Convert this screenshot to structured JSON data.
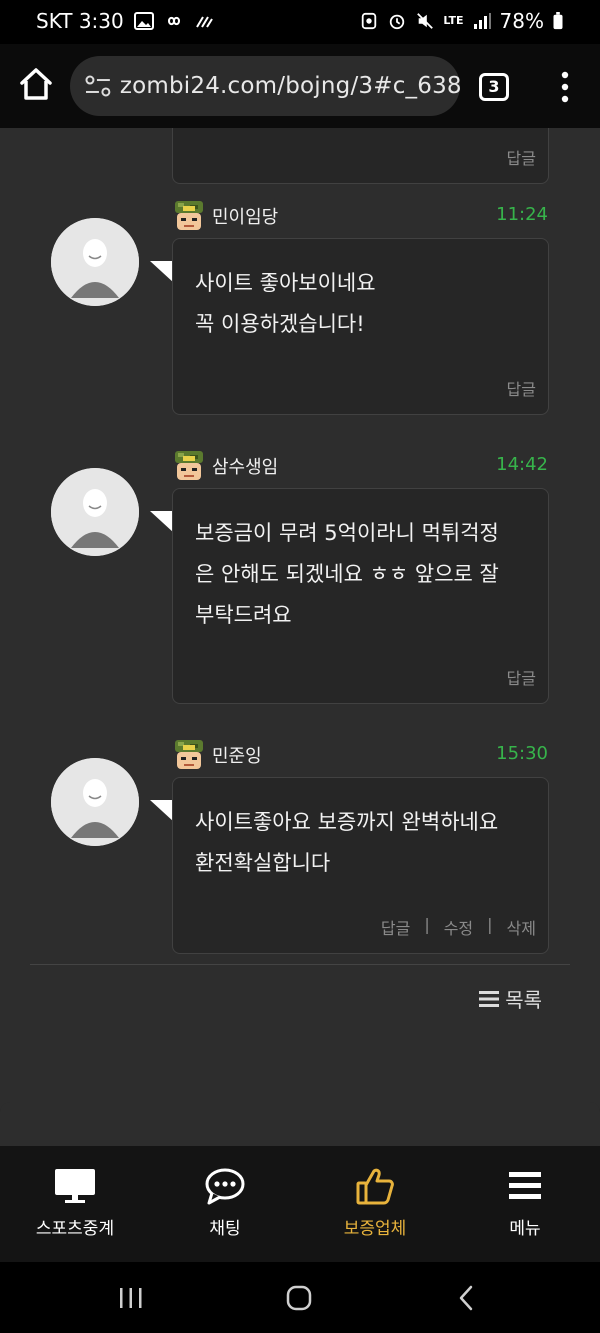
{
  "status": {
    "carrier_time": "SKT 3:30",
    "battery": "78%",
    "network": "LTE"
  },
  "browser": {
    "url": "zombi24.com/bojng/3#c_638",
    "tab_count": "3"
  },
  "comments": [
    {
      "author": "",
      "time": "",
      "text": "",
      "actions": [
        "답글"
      ]
    },
    {
      "author": "민이임당",
      "time": "11:24",
      "text": "사이트 좋아보이네요\n꼭 이용하겠습니다!",
      "actions": [
        "답글"
      ]
    },
    {
      "author": "삼수생임",
      "time": "14:42",
      "text": "보증금이 무려 5억이라니 먹튀걱정\n은 안해도 되겠네요 ㅎㅎ 앞으로 잘\n부탁드려요",
      "actions": [
        "답글"
      ]
    },
    {
      "author": "민준잉",
      "time": "15:30",
      "text": "사이트좋아요 보증까지 완벽하네요\n환전확실합니다",
      "actions": [
        "답글",
        "수정",
        "삭제"
      ]
    }
  ],
  "list_button": "목록",
  "bottom_nav": [
    {
      "label": "스포츠중계",
      "icon": "monitor-icon"
    },
    {
      "label": "채팅",
      "icon": "chat-bubble-icon"
    },
    {
      "label": "보증업체",
      "icon": "thumbs-up-icon",
      "active": true
    },
    {
      "label": "메뉴",
      "icon": "hamburger-icon"
    }
  ],
  "colors": {
    "accent_time": "#37b44b",
    "accent_nav": "#e8b33c",
    "panel": "#2d2d2d",
    "bubble": "#262626"
  }
}
